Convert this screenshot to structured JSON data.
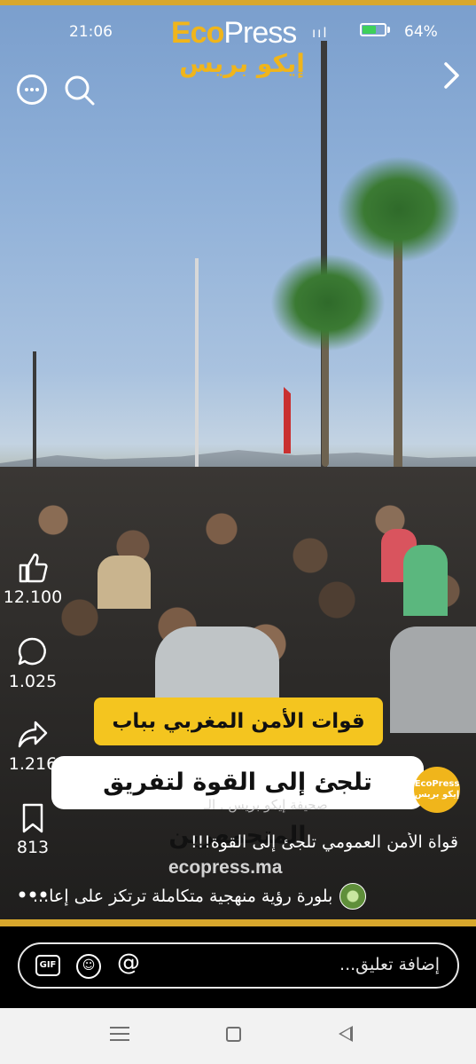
{
  "status_bar": {
    "time": "21:06",
    "signal": "ııl",
    "battery_percent": "64%",
    "battery_level": 0.64,
    "battery_color": "#3ed05a"
  },
  "logo": {
    "eco": "Eco",
    "press": "Press",
    "arabic": "إيكو بريس"
  },
  "top_controls": {
    "more_icon": "more-icon",
    "search_icon": "search-icon",
    "next_icon": "chevron-right-icon"
  },
  "side_actions": {
    "likes": "12.100",
    "comments": "1.025",
    "shares": "1.216",
    "saves": "813",
    "like_icon": "thumbs-up-icon",
    "comment_icon": "comment-icon",
    "share_icon": "share-icon",
    "save_icon": "bookmark-icon",
    "more_icon": "more-horizontal-icon"
  },
  "video": {
    "caption_line1": "قوات الأمن  المغربي بباب سبتة",
    "caption_line2": "تلجئ إلى القوة لتفريق المتجمهرين",
    "watermark_site": "ecopress.ma",
    "watermark_logo": "EcoPress إيكو بريس",
    "account_overlay": "صحيفة إيكو بريس . الـ"
  },
  "post": {
    "description": "قواة الأمن العمومي تلجئ إلى القوة!!!",
    "music_text": "بلورة رؤية منهجية متكاملة ترتكز على إعا..."
  },
  "comment_bar": {
    "gif_label": "GIF",
    "at_label": "@",
    "smile_icon": "emoji-icon",
    "placeholder": "إضافة تعليق..."
  },
  "colors": {
    "brand_gold": "#d8a72c",
    "caption_yellow": "#f4c51f"
  },
  "nav_bar": {
    "menu_icon": "menu-icon",
    "home_icon": "home-square-icon",
    "back_icon": "back-triangle-icon"
  }
}
